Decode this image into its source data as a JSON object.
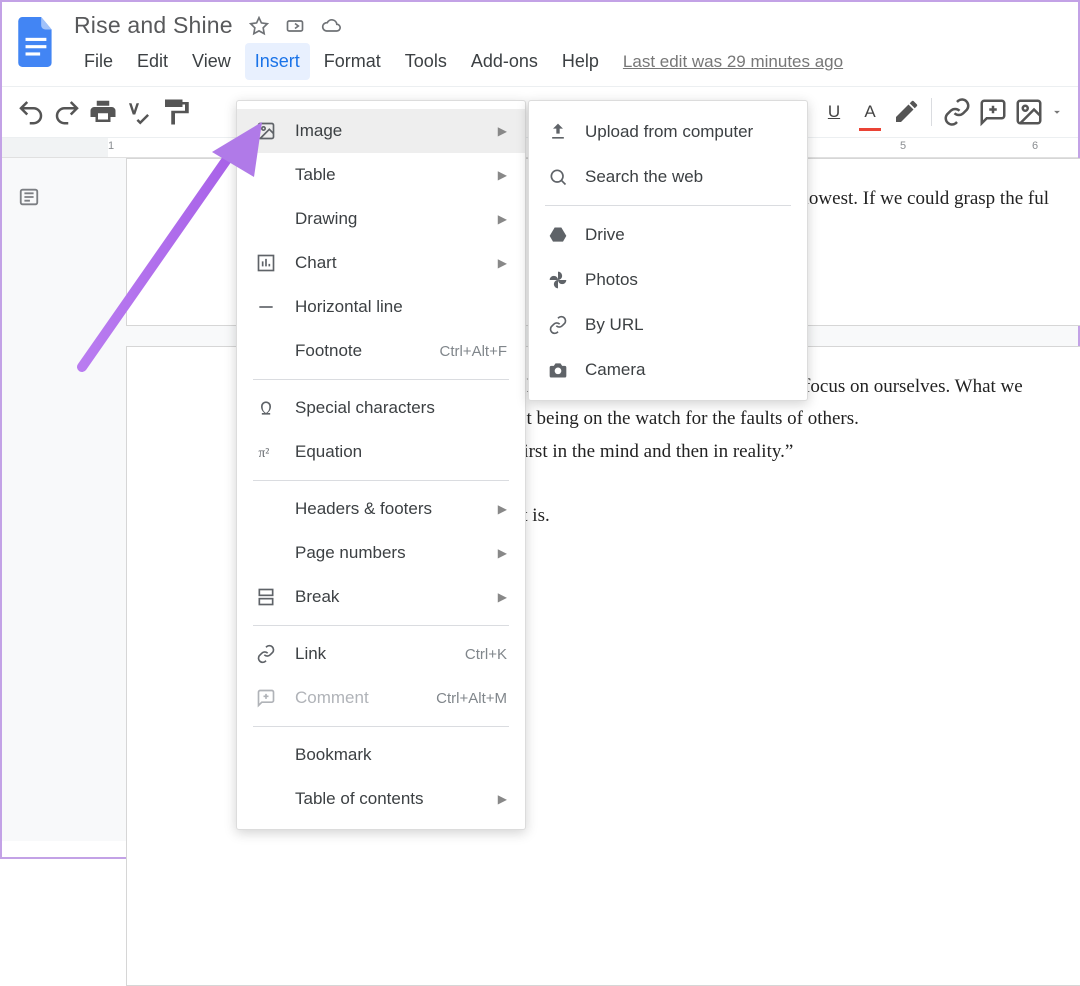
{
  "header": {
    "title": "Rise and Shine",
    "menus": [
      "File",
      "Edit",
      "View",
      "Insert",
      "Format",
      "Tools",
      "Add-ons",
      "Help"
    ],
    "active_menu_index": 3,
    "last_edit": "Last edit was 29 minutes ago"
  },
  "toolbar": {
    "underline": "U",
    "text_color": "A"
  },
  "ruler": {
    "marks": [
      "1",
      "5",
      "6"
    ]
  },
  "insert_menu": {
    "items": [
      {
        "label": "Image",
        "icon": "image-icon",
        "submenu": true,
        "hover": true
      },
      {
        "label": "Table",
        "icon": "",
        "submenu": true
      },
      {
        "label": "Drawing",
        "icon": "",
        "submenu": true
      },
      {
        "label": "Chart",
        "icon": "chart-icon",
        "submenu": true
      },
      {
        "label": "Horizontal line",
        "icon": "hline-icon"
      },
      {
        "label": "Footnote",
        "icon": "",
        "shortcut": "Ctrl+Alt+F",
        "divider_after": true
      },
      {
        "label": "Special characters",
        "icon": "omega-icon"
      },
      {
        "label": "Equation",
        "icon": "pi-icon",
        "divider_after": true
      },
      {
        "label": "Headers & footers",
        "icon": "",
        "submenu": true
      },
      {
        "label": "Page numbers",
        "icon": "",
        "submenu": true
      },
      {
        "label": "Break",
        "icon": "break-icon",
        "submenu": true,
        "divider_after": true
      },
      {
        "label": "Link",
        "icon": "link-icon",
        "shortcut": "Ctrl+K"
      },
      {
        "label": "Comment",
        "icon": "comment-icon",
        "shortcut": "Ctrl+Alt+M",
        "disabled": true,
        "divider_after": true
      },
      {
        "label": "Bookmark",
        "icon": ""
      },
      {
        "label": "Table of contents",
        "icon": "",
        "submenu": true
      }
    ]
  },
  "image_submenu": {
    "items": [
      {
        "label": "Upload from computer",
        "icon": "upload-icon"
      },
      {
        "label": "Search the web",
        "icon": "search-icon",
        "divider_after": true
      },
      {
        "label": "Drive",
        "icon": "drive-icon"
      },
      {
        "label": "Photos",
        "icon": "photos-icon"
      },
      {
        "label": "By URL",
        "icon": "link-icon"
      },
      {
        "label": "Camera",
        "icon": "camera-icon"
      }
    ]
  },
  "document": {
    "page1_line": "e lowest. If we could grasp the ful",
    "page2_line1": "oking for Sheitan outside and instead focus on ourselves. What we",
    "page2_line2": "ot being on the watch for the faults of others.",
    "page2_line3": "first in the mind and then in reality.”",
    "page2_line4a": ",",
    "page2_line4b": " it is."
  }
}
